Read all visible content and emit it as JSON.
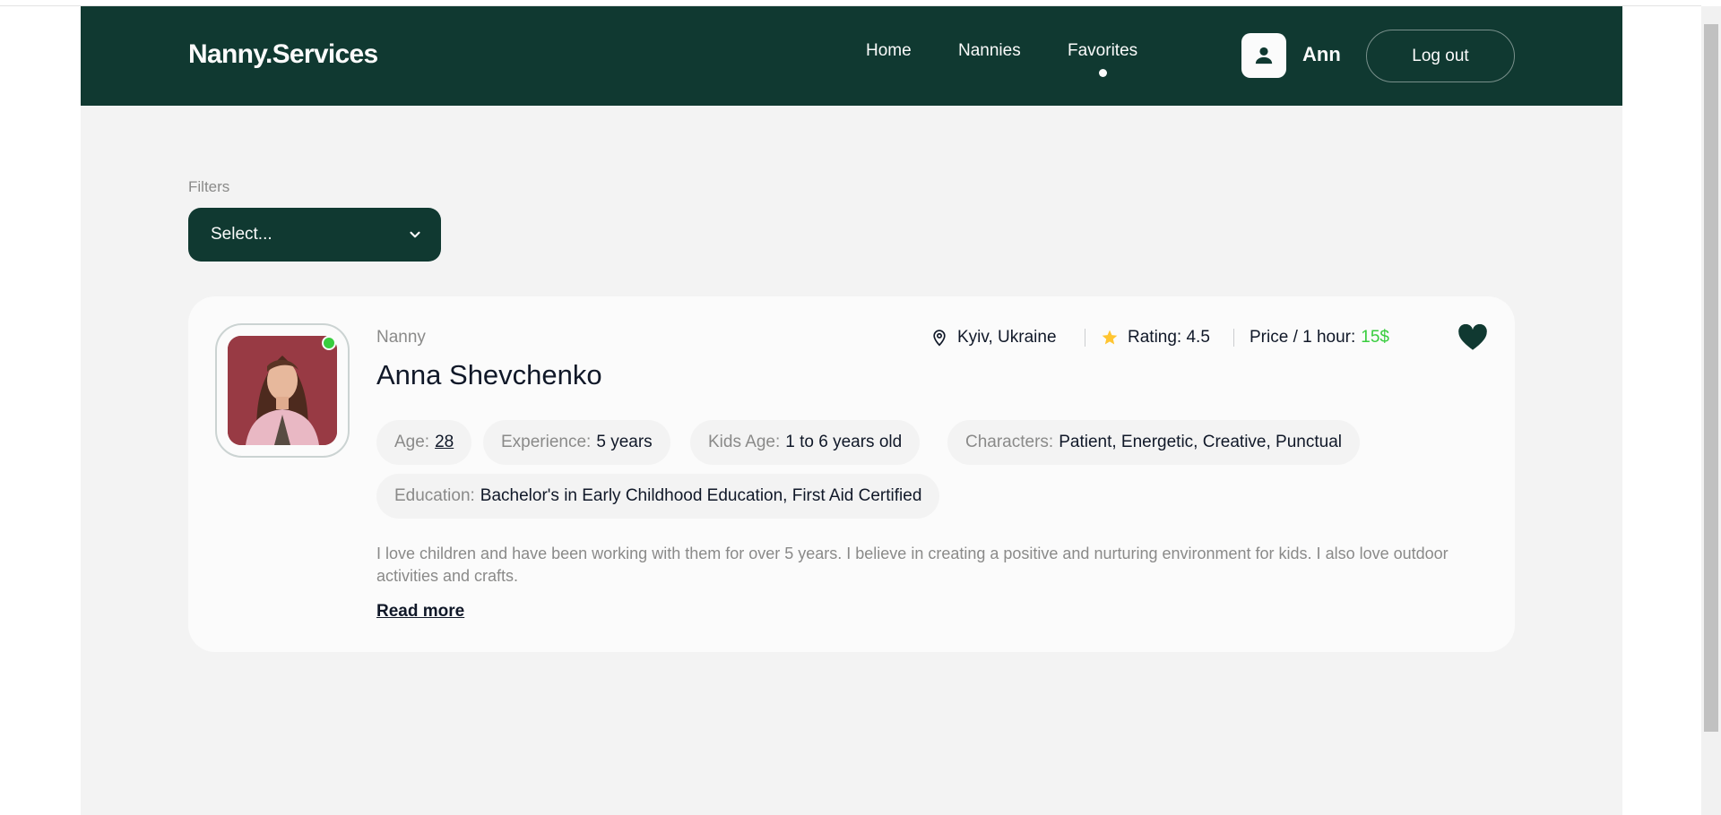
{
  "header": {
    "logo": "Nanny.Services",
    "nav": {
      "home": "Home",
      "nannies": "Nannies",
      "favorites": "Favorites"
    },
    "user_name": "Ann",
    "logout_label": "Log out"
  },
  "filters": {
    "label": "Filters",
    "select_value": "Select..."
  },
  "card": {
    "role": "Nanny",
    "name": "Anna Shevchenko",
    "location": "Kyiv, Ukraine",
    "rating_label": "Rating: 4.5",
    "price_label": "Price / 1 hour:",
    "price_value": "15$",
    "favorited": true,
    "online": true,
    "chips": {
      "age_key": "Age:",
      "age_val": "28",
      "experience_key": "Experience:",
      "experience_val": "5 years",
      "kids_age_key": "Kids Age:",
      "kids_age_val": "1 to 6 years old",
      "characters_key": "Characters:",
      "characters_val": "Patient, Energetic, Creative, Punctual",
      "education_key": "Education:",
      "education_val": "Bachelor's in Early Childhood Education, First Aid Certified"
    },
    "description": "I love children and have been working with them for over 5 years. I believe in creating a positive and nurturing environment for kids. I also love outdoor activities and crafts.",
    "read_more": "Read more"
  },
  "colors": {
    "brand": "#103931",
    "page_bg": "#f3f3f3",
    "card_bg": "#fbfbfb",
    "accent_green": "#38cd3e",
    "star": "#ffc531",
    "muted_text": "#8a8a89"
  },
  "icons": [
    "user-icon",
    "chevron-down-icon",
    "map-pin-icon",
    "star-icon",
    "heart-icon"
  ]
}
